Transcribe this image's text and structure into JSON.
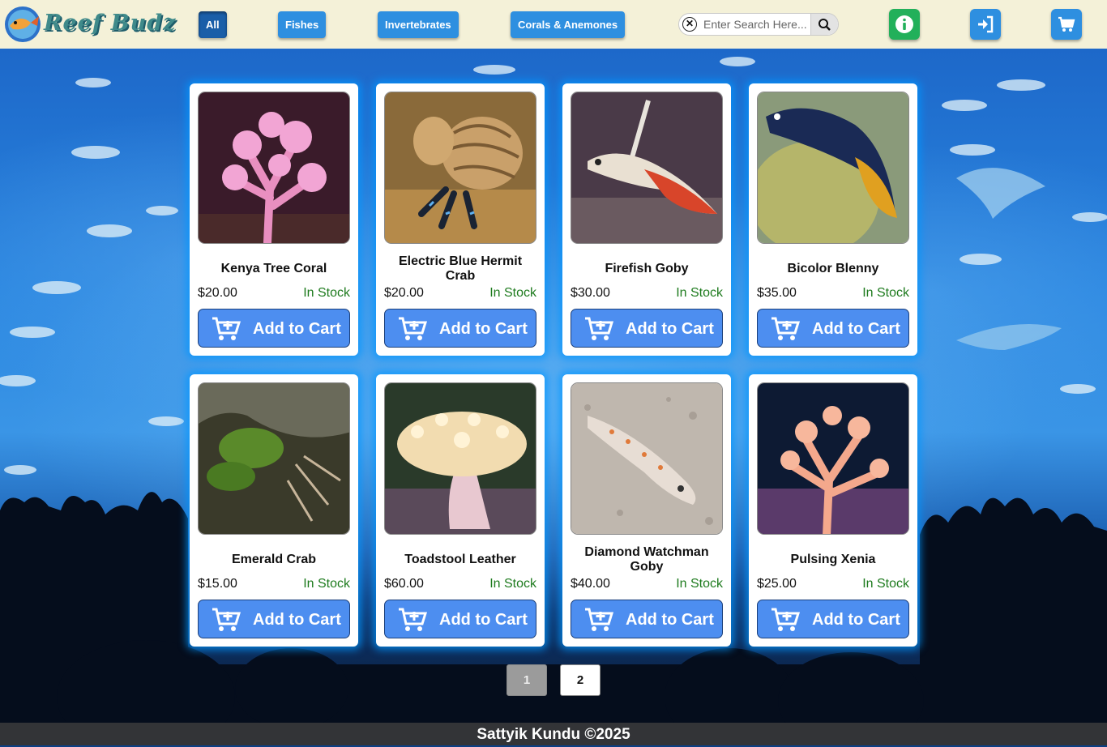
{
  "header": {
    "brand": "Reef Budz",
    "nav": [
      "All",
      "Fishes",
      "Invertebrates",
      "Corals & Anemones"
    ],
    "active_nav": "All",
    "search": {
      "placeholder": "Enter Search Here...",
      "value": ""
    },
    "icons": [
      "info-icon",
      "login-icon",
      "cart-icon"
    ]
  },
  "products": [
    {
      "name": "Kenya Tree Coral",
      "price": "$20.00",
      "stock": "In Stock",
      "button": "Add to Cart",
      "art": "coral-pink"
    },
    {
      "name": "Electric Blue Hermit Crab",
      "price": "$20.00",
      "stock": "In Stock",
      "button": "Add to Cart",
      "art": "hermit-crab"
    },
    {
      "name": "Firefish Goby",
      "price": "$30.00",
      "stock": "In Stock",
      "button": "Add to Cart",
      "art": "firefish"
    },
    {
      "name": "Bicolor Blenny",
      "price": "$35.00",
      "stock": "In Stock",
      "button": "Add to Cart",
      "art": "blenny"
    },
    {
      "name": "Emerald Crab",
      "price": "$15.00",
      "stock": "In Stock",
      "button": "Add to Cart",
      "art": "emerald-crab"
    },
    {
      "name": "Toadstool Leather",
      "price": "$60.00",
      "stock": "In Stock",
      "button": "Add to Cart",
      "art": "toadstool"
    },
    {
      "name": "Diamond Watchman Goby",
      "price": "$40.00",
      "stock": "In Stock",
      "button": "Add to Cart",
      "art": "watchman"
    },
    {
      "name": "Pulsing Xenia",
      "price": "$25.00",
      "stock": "In Stock",
      "button": "Add to Cart",
      "art": "xenia"
    }
  ],
  "pagination": {
    "current": "1",
    "next": "2"
  },
  "footer": "Sattyik Kundu ©2025",
  "colors": {
    "header_bg": "#f4f1d8",
    "nav_button": "#2e8fe0",
    "cart_button": "#4d8ef0",
    "in_stock": "#1e7b1e"
  }
}
